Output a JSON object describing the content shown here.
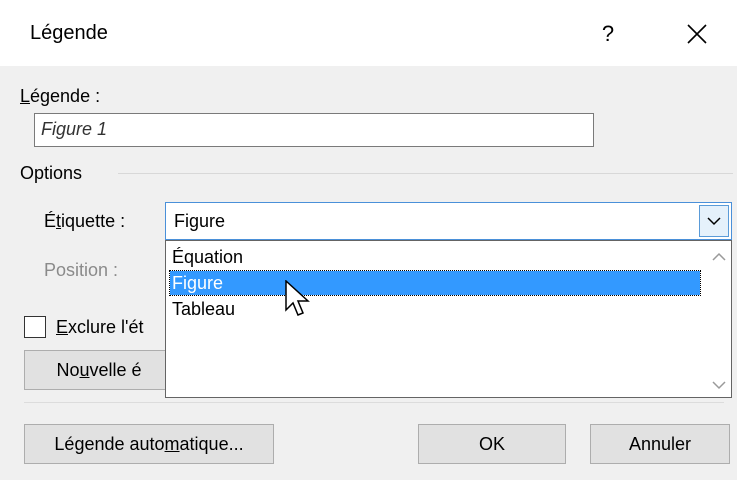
{
  "window": {
    "title": "Légende",
    "help": "?"
  },
  "caption": {
    "label_first": "L",
    "label_rest": "égende :",
    "value": "Figure 1"
  },
  "options": {
    "group_label": "Options",
    "etiquette": {
      "label_a": "É",
      "label_u": "t",
      "label_b": "iquette :",
      "value": "Figure"
    },
    "position_label": "Position :",
    "dropdown_options": [
      "Équation",
      "Figure",
      "Tableau"
    ],
    "selected_index": 1,
    "exclude": {
      "label_u": "E",
      "label_b": "xclure l'ét",
      "checked": false
    },
    "new_label": {
      "a": "No",
      "u": "u",
      "b": "velle é"
    }
  },
  "buttons": {
    "auto_a": "Légende auto",
    "auto_u": "m",
    "auto_b": "atique...",
    "ok": "OK",
    "cancel": "Annuler"
  }
}
